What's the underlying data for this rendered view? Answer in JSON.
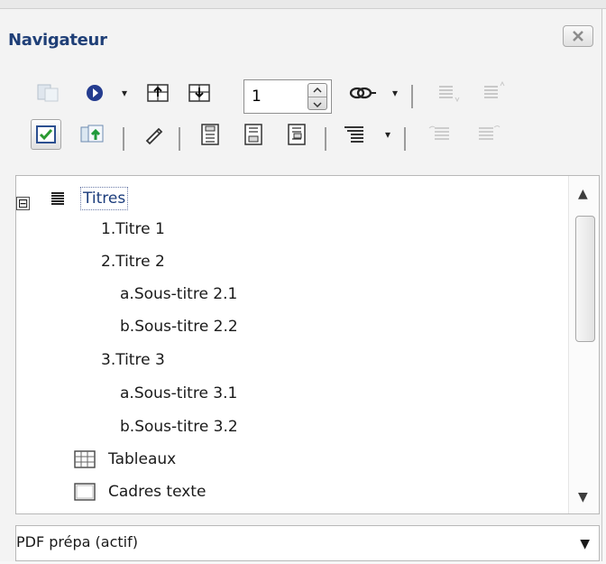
{
  "window": {
    "title": "Navigateur",
    "close_icon": "close-x-icon"
  },
  "toolbar": {
    "page_number": "1"
  },
  "tree": {
    "root": "Titres",
    "items": [
      {
        "label": "1.Titre 1"
      },
      {
        "label": "2.Titre 2"
      },
      {
        "label": "a.Sous-titre 2.1"
      },
      {
        "label": "b.Sous-titre 2.2"
      },
      {
        "label": "3.Titre 3"
      },
      {
        "label": "a.Sous-titre 3.1"
      },
      {
        "label": "b.Sous-titre 3.2"
      },
      {
        "label": "Tableaux"
      },
      {
        "label": "Cadres texte"
      }
    ],
    "collapse_symbol": "⊟"
  },
  "document_select": {
    "value": "PDF prépa (actif)"
  },
  "colors": {
    "title": "#1f3f77",
    "background": "#f3f3f3"
  }
}
